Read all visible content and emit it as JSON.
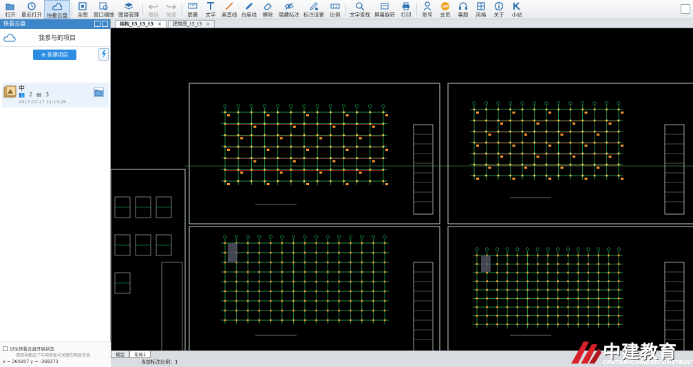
{
  "toolbar": {
    "items": [
      {
        "label": "打开",
        "icon": "folder-open-icon"
      },
      {
        "label": "最近打开",
        "icon": "clock-icon"
      },
      {
        "label": "快看云盘",
        "icon": "cloud-icon"
      },
      {
        "label": "全图",
        "icon": "fit-view-icon"
      },
      {
        "label": "窗口缩放",
        "icon": "zoom-window-icon"
      },
      {
        "label": "图层管理",
        "icon": "layers-icon"
      },
      {
        "label": "撤销",
        "icon": "undo-icon"
      },
      {
        "label": "恢复",
        "icon": "redo-icon"
      },
      {
        "label": "联量",
        "icon": "measure-icon"
      },
      {
        "label": "文字",
        "icon": "text-icon"
      },
      {
        "label": "画直线",
        "icon": "line-icon"
      },
      {
        "label": "台度线",
        "icon": "pencil-icon"
      },
      {
        "label": "擦除",
        "icon": "eraser-icon"
      },
      {
        "label": "隐藏标注",
        "icon": "eye-icon"
      },
      {
        "label": "标注设置",
        "icon": "annotation-settings-icon"
      },
      {
        "label": "比例",
        "icon": "scale-icon"
      },
      {
        "label": "文字查找",
        "icon": "search-text-icon"
      },
      {
        "label": "屏幕旋转",
        "icon": "rotate-screen-icon"
      },
      {
        "label": "打印",
        "icon": "printer-icon"
      },
      {
        "label": "账号",
        "icon": "user-icon"
      },
      {
        "label": "会员",
        "icon": "vip-icon"
      },
      {
        "label": "客服",
        "icon": "headset-icon"
      },
      {
        "label": "风格",
        "icon": "palette-icon"
      },
      {
        "label": "关于",
        "icon": "info-icon"
      },
      {
        "label": "小站",
        "icon": "k-logo-icon"
      }
    ]
  },
  "panel": {
    "title": "快看云盘",
    "heading": "我参与的项目",
    "new_button": "新建项目",
    "project": {
      "name": "中",
      "members": "2",
      "files": "3",
      "date": "2017-07-17 11:13:26"
    },
    "remember_label": "记住快看云盘开启状态",
    "hint": "请到界面出了与项目账号关联的项目信息",
    "coords": "x = 360207  y = -368373"
  },
  "tabs": [
    {
      "label": "结构_t3_t3_t3",
      "active": true
    },
    {
      "label": "建筑图_t3_t3",
      "active": false
    }
  ],
  "bottom": {
    "layout_tabs": [
      "模型",
      "布局1"
    ],
    "scale_text": "当前标注比例：1"
  },
  "logo": {
    "title": "中建教育",
    "subtitle": "CENTURYCHINESECONSTRUCTION"
  },
  "colors": {
    "accent": "#2c8de2",
    "panel_title": "#3d86c9",
    "cad_grid": "#22c55e",
    "cad_frame": "#c9d6c9",
    "cad_marks": "#ff9a2a",
    "cad_beams": "#ff3030"
  }
}
